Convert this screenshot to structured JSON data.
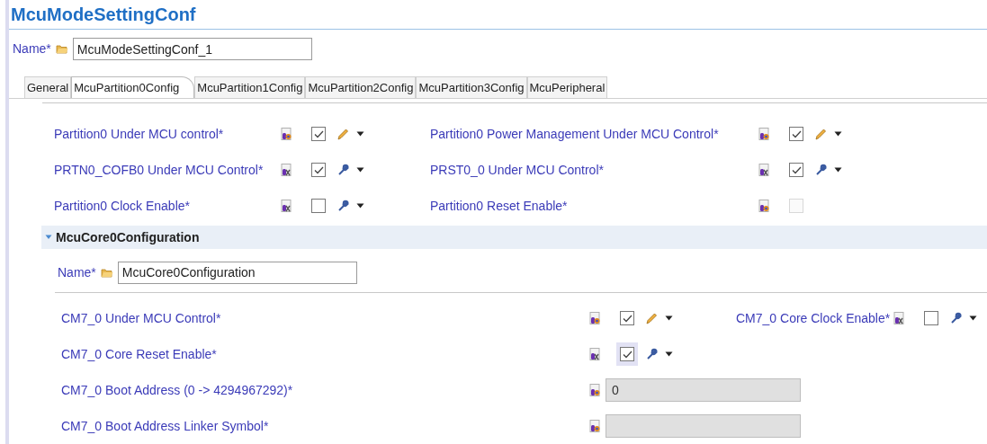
{
  "title": "McuModeSettingConf",
  "name": {
    "label": "Name*",
    "value": "McuModeSettingConf_1"
  },
  "tabs": [
    {
      "label": "General",
      "selected": false
    },
    {
      "label": "McuPartition0Config",
      "selected": true
    },
    {
      "label": "McuPartition1Config",
      "selected": false
    },
    {
      "label": "McuPartition2Config",
      "selected": false
    },
    {
      "label": "McuPartition3Config",
      "selected": false
    },
    {
      "label": "McuPeripheral",
      "selected": false
    }
  ],
  "partition_rows": [
    {
      "left": {
        "label": "Partition0 Under MCU control*",
        "kind": "checkbox",
        "post_build": false,
        "checked": true,
        "disabled": false,
        "user_edited": true
      },
      "right": {
        "label": "Partition0 Power Management Under MCU Control*",
        "kind": "checkbox",
        "post_build": false,
        "checked": true,
        "disabled": false,
        "user_edited": true
      }
    },
    {
      "left": {
        "label": "PRTN0_COFB0 Under MCU Control*",
        "kind": "checkbox",
        "post_build": true,
        "checked": true,
        "disabled": false,
        "user_edited": false
      },
      "right": {
        "label": "PRST0_0 Under MCU Control*",
        "kind": "checkbox",
        "post_build": true,
        "checked": true,
        "disabled": false,
        "user_edited": false
      }
    },
    {
      "left": {
        "label": "Partition0 Clock Enable*",
        "kind": "checkbox",
        "post_build": true,
        "checked": false,
        "disabled": false,
        "user_edited": false
      },
      "right": {
        "label": "Partition0 Reset Enable*",
        "kind": "checkbox",
        "post_build": false,
        "checked": false,
        "disabled": true
      }
    }
  ],
  "section": {
    "title": "McuCore0Configuration",
    "expanded": true,
    "name": {
      "label": "Name*",
      "value": "McuCore0Configuration"
    },
    "rows": [
      {
        "left": {
          "label": "CM7_0 Under MCU Control*",
          "kind": "checkbox",
          "post_build": false,
          "checked": true,
          "disabled": false,
          "focused": false,
          "user_edited": true
        },
        "right": {
          "label": "CM7_0 Core Clock Enable*",
          "kind": "checkbox",
          "post_build": true,
          "checked": false,
          "disabled": false,
          "focused": false,
          "user_edited": false
        }
      },
      {
        "left": {
          "label": "CM7_0 Core Reset Enable*",
          "kind": "checkbox",
          "post_build": true,
          "checked": true,
          "disabled": false,
          "focused": true,
          "user_edited": false
        }
      },
      {
        "left": {
          "label": "CM7_0 Boot Address (0 -> 4294967292)*",
          "kind": "text",
          "post_build": false,
          "value": "0"
        }
      },
      {
        "left": {
          "label": "CM7_0 Boot Address Linker Symbol*",
          "kind": "text",
          "post_build": false
        }
      }
    ]
  }
}
